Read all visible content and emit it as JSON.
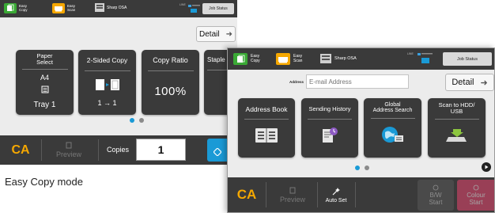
{
  "copy_screen": {
    "tabs": [
      {
        "line1": "Easy",
        "line2": "Copy",
        "icon": "easy-copy-icon",
        "color": "#3aa935"
      },
      {
        "line1": "Easy",
        "line2": "Scan",
        "icon": "easy-scan-icon",
        "color": "#f6a800"
      },
      {
        "label": "Sharp OSA",
        "icon": "sharp-osa-icon"
      }
    ],
    "status_text": "LINE",
    "job_status_label": "Job Status",
    "detail_label": "Detail",
    "tiles": [
      {
        "title_line1": "Paper",
        "title_line2": "Select",
        "value_top": "A4",
        "value_bottom": "Tray 1"
      },
      {
        "title": "2-Sided Copy",
        "value": "1 → 1"
      },
      {
        "title": "Copy Ratio",
        "value": "100%"
      },
      {
        "title": "Staple"
      }
    ],
    "page_dots": {
      "count": 2,
      "active": 0
    },
    "bottom": {
      "ca_label": "CA",
      "preview_label": "Preview",
      "copies_label": "Copies",
      "copies_value": "1"
    }
  },
  "caption": "Easy Copy mode",
  "send_screen": {
    "tabs": [
      {
        "line1": "Easy",
        "line2": "Copy",
        "icon": "easy-copy-icon",
        "color": "#3aa935"
      },
      {
        "line1": "Easy",
        "line2": "Scan",
        "icon": "easy-scan-icon",
        "color": "#f6a800"
      },
      {
        "label": "Sharp OSA",
        "icon": "sharp-osa-icon"
      }
    ],
    "status_text": "LINE",
    "job_status_label": "Job Status",
    "address_label": "Address",
    "address_placeholder": "E-mail Address",
    "detail_label": "Detail",
    "tiles": [
      {
        "title": "Address Book",
        "icon": "address-book-icon"
      },
      {
        "title": "Sending History",
        "icon": "sending-history-icon"
      },
      {
        "title_line1": "Global",
        "title_line2": "Address Search",
        "icon": "global-address-search-icon"
      },
      {
        "title_line1": "Scan to HDD/",
        "title_line2": "USB",
        "icon": "scan-to-hdd-usb-icon"
      }
    ],
    "page_dots": {
      "count": 2,
      "active": 0
    },
    "bottom": {
      "ca_label": "CA",
      "preview_label": "Preview",
      "auto_set_label": "Auto Set",
      "bw_start_line1": "B/W",
      "bw_start_line2": "Start",
      "colour_start_line1": "Colour",
      "colour_start_line2": "Start"
    },
    "colors": {
      "colour_start": "#e7446e",
      "ca": "#f6a800",
      "accent_blue": "#1a9ad6"
    }
  }
}
